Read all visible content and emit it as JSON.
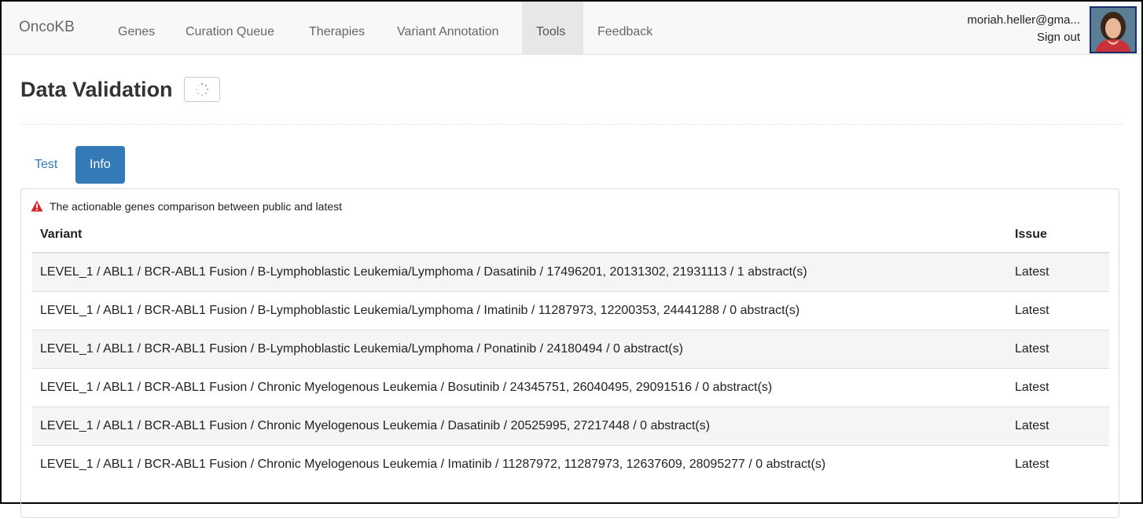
{
  "nav": {
    "brand": "OncoKB",
    "items": [
      "Genes",
      "Curation Queue",
      "Therapies",
      "Variant Annotation",
      "Tools",
      "Feedback"
    ],
    "active_index": 4,
    "user_email": "moriah.heller@gma...",
    "sign_out": "Sign out"
  },
  "page": {
    "title": "Data Validation"
  },
  "tabs": {
    "test": "Test",
    "info": "Info",
    "active": "Info"
  },
  "panel": {
    "alert_text": "The actionable genes comparison between public and latest",
    "columns": [
      "Variant",
      "Issue"
    ],
    "rows": [
      {
        "variant": "LEVEL_1 / ABL1 / BCR-ABL1 Fusion / B-Lymphoblastic Leukemia/Lymphoma / Dasatinib / 17496201, 20131302, 21931113 / 1 abstract(s)",
        "issue": "Latest"
      },
      {
        "variant": "LEVEL_1 / ABL1 / BCR-ABL1 Fusion / B-Lymphoblastic Leukemia/Lymphoma / Imatinib / 11287973, 12200353, 24441288 / 0 abstract(s)",
        "issue": "Latest"
      },
      {
        "variant": "LEVEL_1 / ABL1 / BCR-ABL1 Fusion / B-Lymphoblastic Leukemia/Lymphoma / Ponatinib / 24180494 / 0 abstract(s)",
        "issue": "Latest"
      },
      {
        "variant": "LEVEL_1 / ABL1 / BCR-ABL1 Fusion / Chronic Myelogenous Leukemia / Bosutinib / 24345751, 26040495, 29091516 / 0 abstract(s)",
        "issue": "Latest"
      },
      {
        "variant": "LEVEL_1 / ABL1 / BCR-ABL1 Fusion / Chronic Myelogenous Leukemia / Dasatinib / 20525995, 27217448 / 0 abstract(s)",
        "issue": "Latest"
      },
      {
        "variant": "LEVEL_1 / ABL1 / BCR-ABL1 Fusion / Chronic Myelogenous Leukemia / Imatinib / 11287972, 11287973, 12637609, 28095277 / 0 abstract(s)",
        "issue": "Latest"
      }
    ]
  },
  "colors": {
    "primary": "#337ab7",
    "alert_icon": "#d9262a",
    "navbar_bg": "#f8f8f8"
  },
  "icons": {
    "loading": "spinner-icon",
    "alert": "warning-triangle-icon"
  }
}
